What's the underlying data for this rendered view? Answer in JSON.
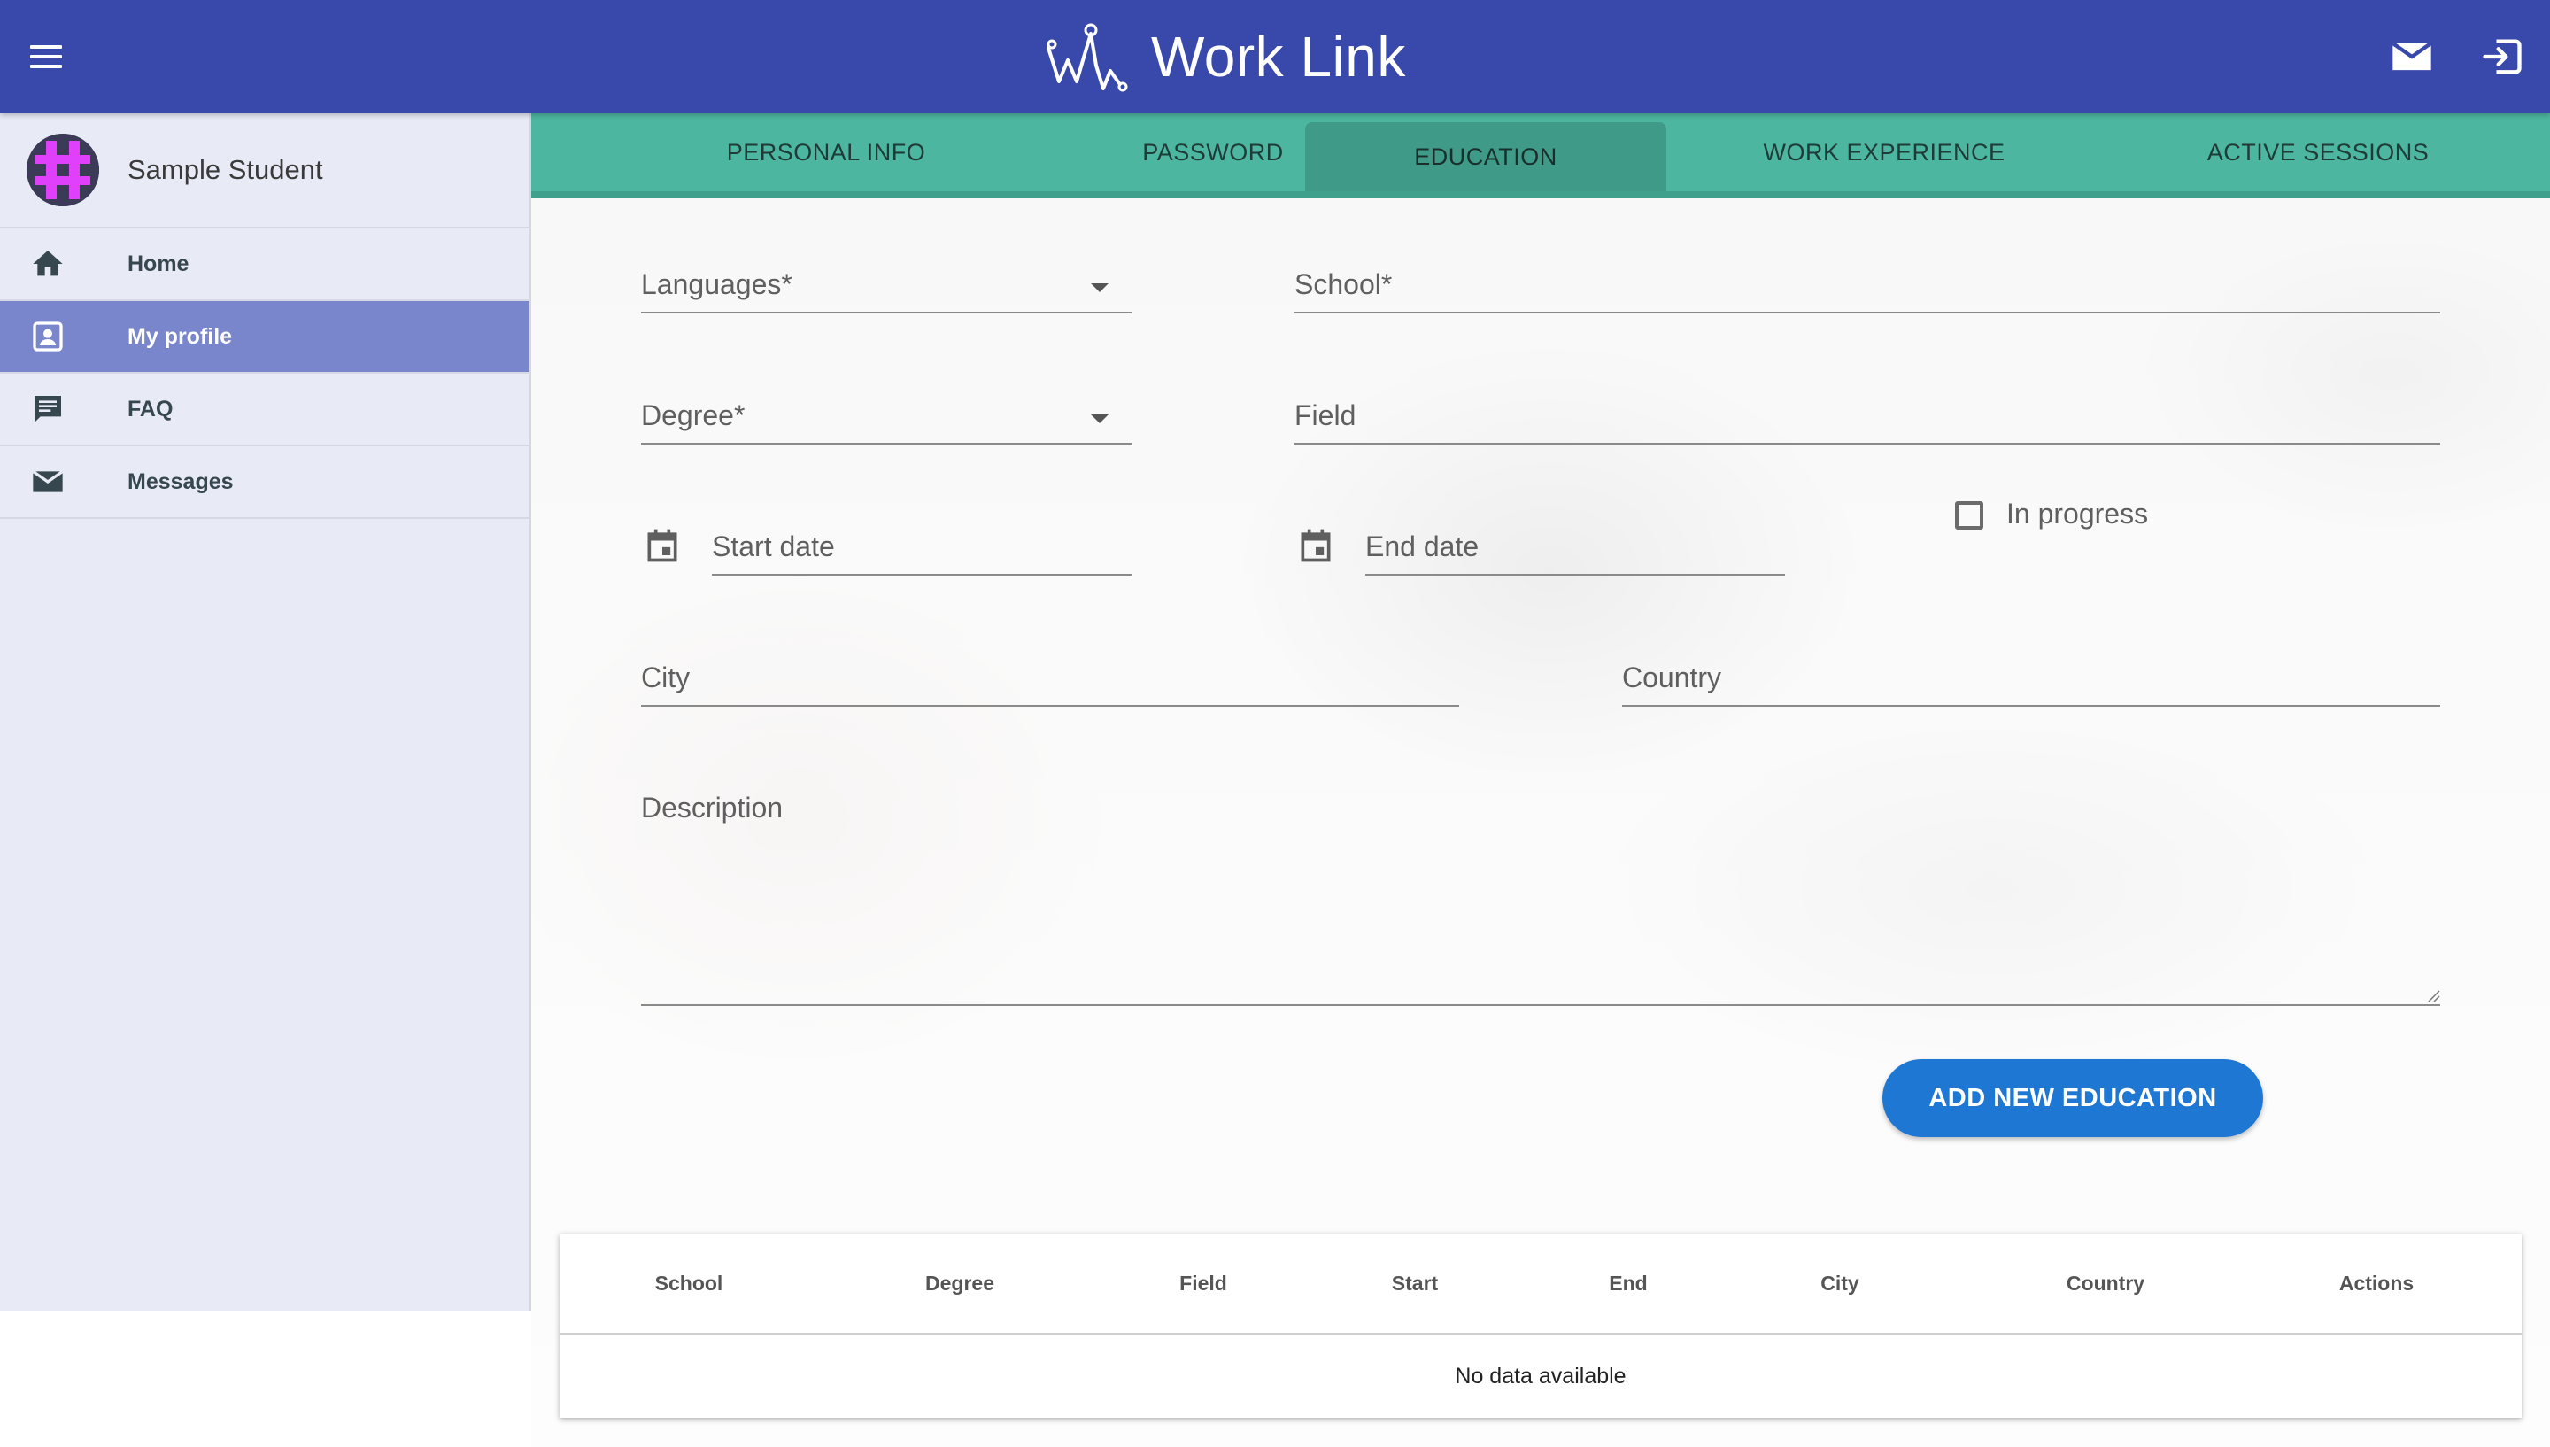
{
  "app": {
    "title": "Work Link"
  },
  "header_icons": [
    "menu-icon",
    "mail-icon",
    "logout-icon"
  ],
  "colors": {
    "appbar": "#3949ab",
    "tabs": "#4db6a0",
    "sidebar": "#e8eaf6",
    "active_nav": "#7986cb",
    "primary_button": "#1e77d3"
  },
  "user": {
    "name": "Sample Student"
  },
  "sidebar": {
    "items": [
      {
        "label": "Home",
        "icon": "home-icon"
      },
      {
        "label": "My profile",
        "icon": "contact-card-icon",
        "active": true
      },
      {
        "label": "FAQ",
        "icon": "chat-icon"
      },
      {
        "label": "Messages",
        "icon": "mail-icon"
      }
    ]
  },
  "tabs": [
    {
      "label": "PERSONAL INFO"
    },
    {
      "label": "PASSWORD"
    },
    {
      "label": "EDUCATION",
      "active": true
    },
    {
      "label": "WORK EXPERIENCE"
    },
    {
      "label": "ACTIVE SESSIONS"
    }
  ],
  "form": {
    "languages_label": "Languages*",
    "school_label": "School*",
    "degree_label": "Degree*",
    "field_label": "Field",
    "start_date_label": "Start date",
    "end_date_label": "End date",
    "in_progress_label": "In progress",
    "in_progress_checked": false,
    "city_label": "City",
    "country_label": "Country",
    "description_label": "Description",
    "add_button_label": "ADD NEW EDUCATION"
  },
  "table": {
    "columns": [
      "School",
      "Degree",
      "Field",
      "Start",
      "End",
      "City",
      "Country",
      "Actions"
    ],
    "empty_text": "No data available",
    "rows": []
  }
}
